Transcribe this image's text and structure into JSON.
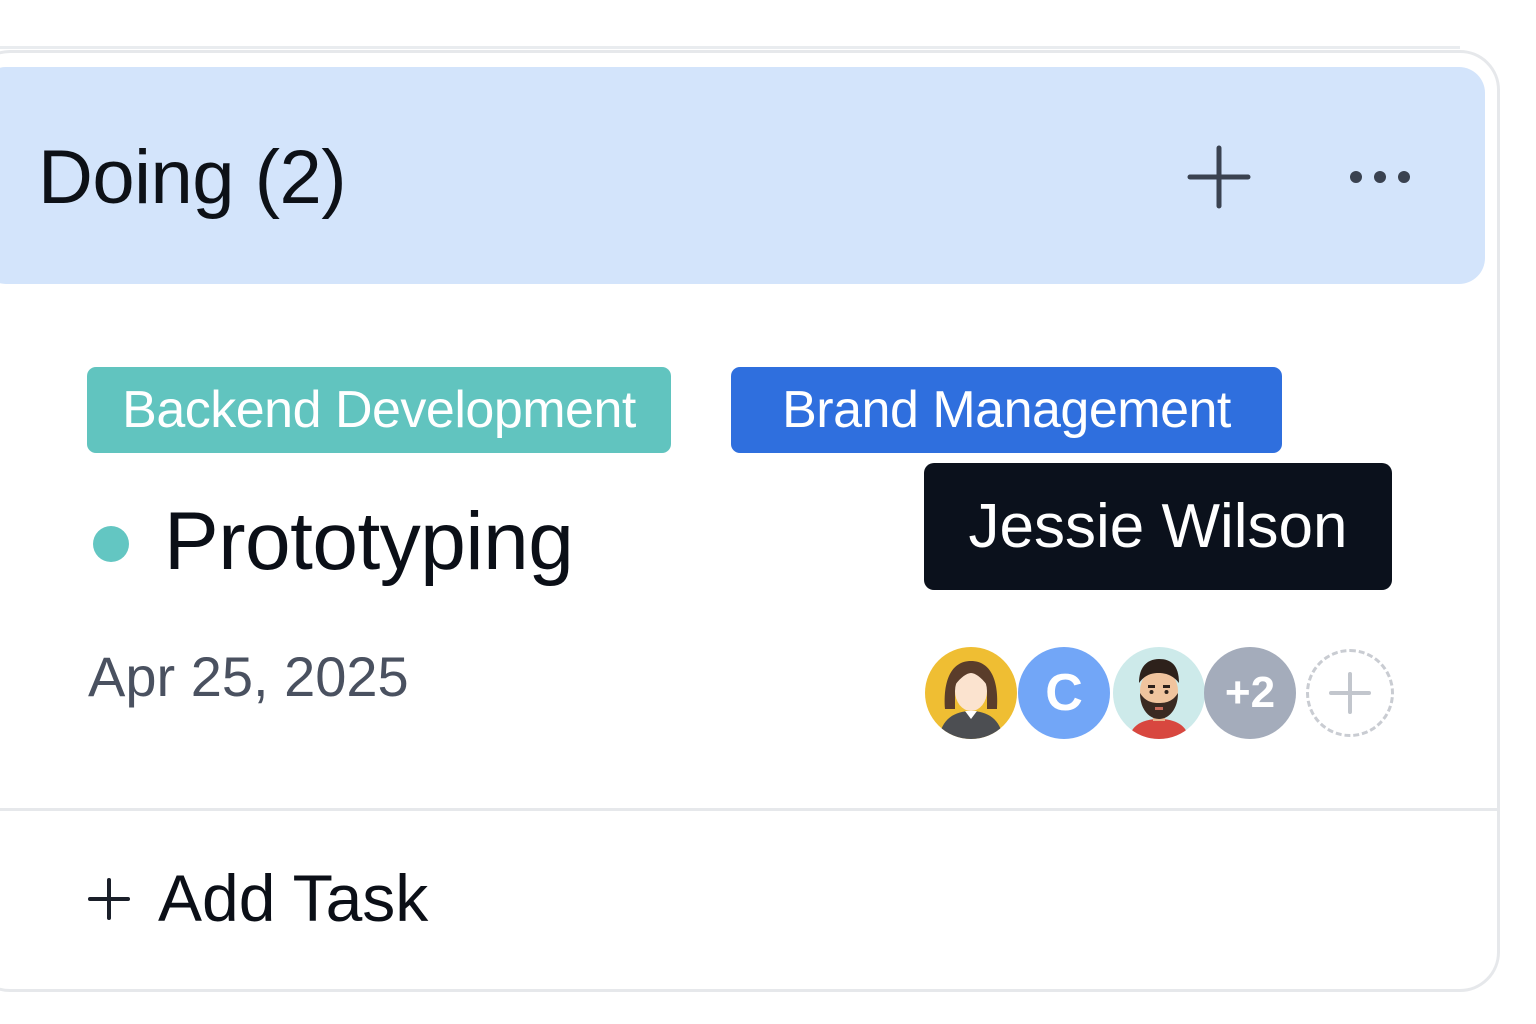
{
  "column": {
    "title": "Doing (2)",
    "header_color": "#d3e4fb",
    "icons": {
      "add": "plus-icon",
      "more": "more-horizontal-icon"
    }
  },
  "card": {
    "tags": [
      {
        "label": "Backend Development",
        "color": "#61c4bf"
      },
      {
        "label": "Brand Management",
        "color": "#2f6fde"
      }
    ],
    "status_color": "#63c6c2",
    "title": "Prototyping",
    "due_date": "Apr 25, 2025",
    "tooltip": "Jessie Wilson",
    "assignees": [
      {
        "kind": "image",
        "icon": "woman-avatar"
      },
      {
        "kind": "initial",
        "initial": "C"
      },
      {
        "kind": "image",
        "icon": "bearded-man-avatar"
      },
      {
        "kind": "overflow",
        "label": "+2"
      }
    ]
  },
  "footer": {
    "add_task_label": "Add Task"
  }
}
